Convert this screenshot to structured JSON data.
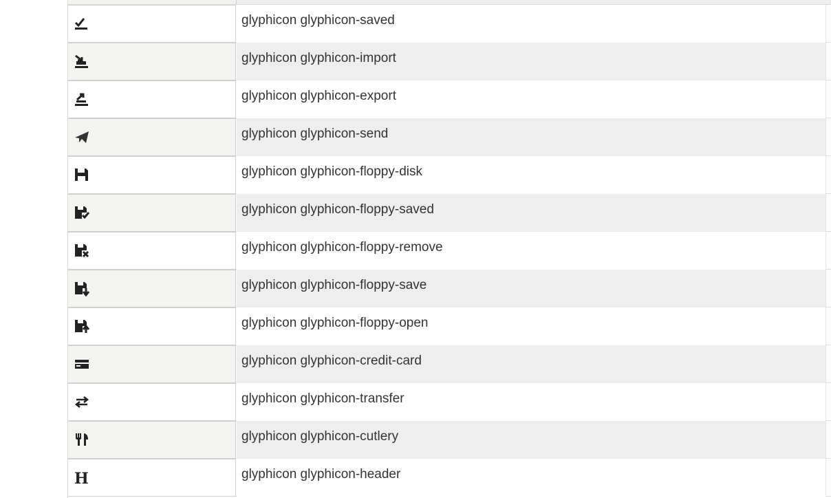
{
  "rows": [
    {
      "icon": "saved-icon",
      "class_name": "glyphicon glyphicon-saved"
    },
    {
      "icon": "import-icon",
      "class_name": "glyphicon glyphicon-import"
    },
    {
      "icon": "export-icon",
      "class_name": "glyphicon glyphicon-export"
    },
    {
      "icon": "send-icon",
      "class_name": "glyphicon glyphicon-send"
    },
    {
      "icon": "floppy-disk-icon",
      "class_name": "glyphicon glyphicon-floppy-disk"
    },
    {
      "icon": "floppy-saved-icon",
      "class_name": "glyphicon glyphicon-floppy-saved"
    },
    {
      "icon": "floppy-remove-icon",
      "class_name": "glyphicon glyphicon-floppy-remove"
    },
    {
      "icon": "floppy-save-icon",
      "class_name": "glyphicon glyphicon-floppy-save"
    },
    {
      "icon": "floppy-open-icon",
      "class_name": "glyphicon glyphicon-floppy-open"
    },
    {
      "icon": "credit-card-icon",
      "class_name": "glyphicon glyphicon-credit-card"
    },
    {
      "icon": "transfer-icon",
      "class_name": "glyphicon glyphicon-transfer"
    },
    {
      "icon": "cutlery-icon",
      "class_name": "glyphicon glyphicon-cutlery"
    },
    {
      "icon": "header-icon",
      "class_name": "glyphicon glyphicon-header"
    }
  ]
}
